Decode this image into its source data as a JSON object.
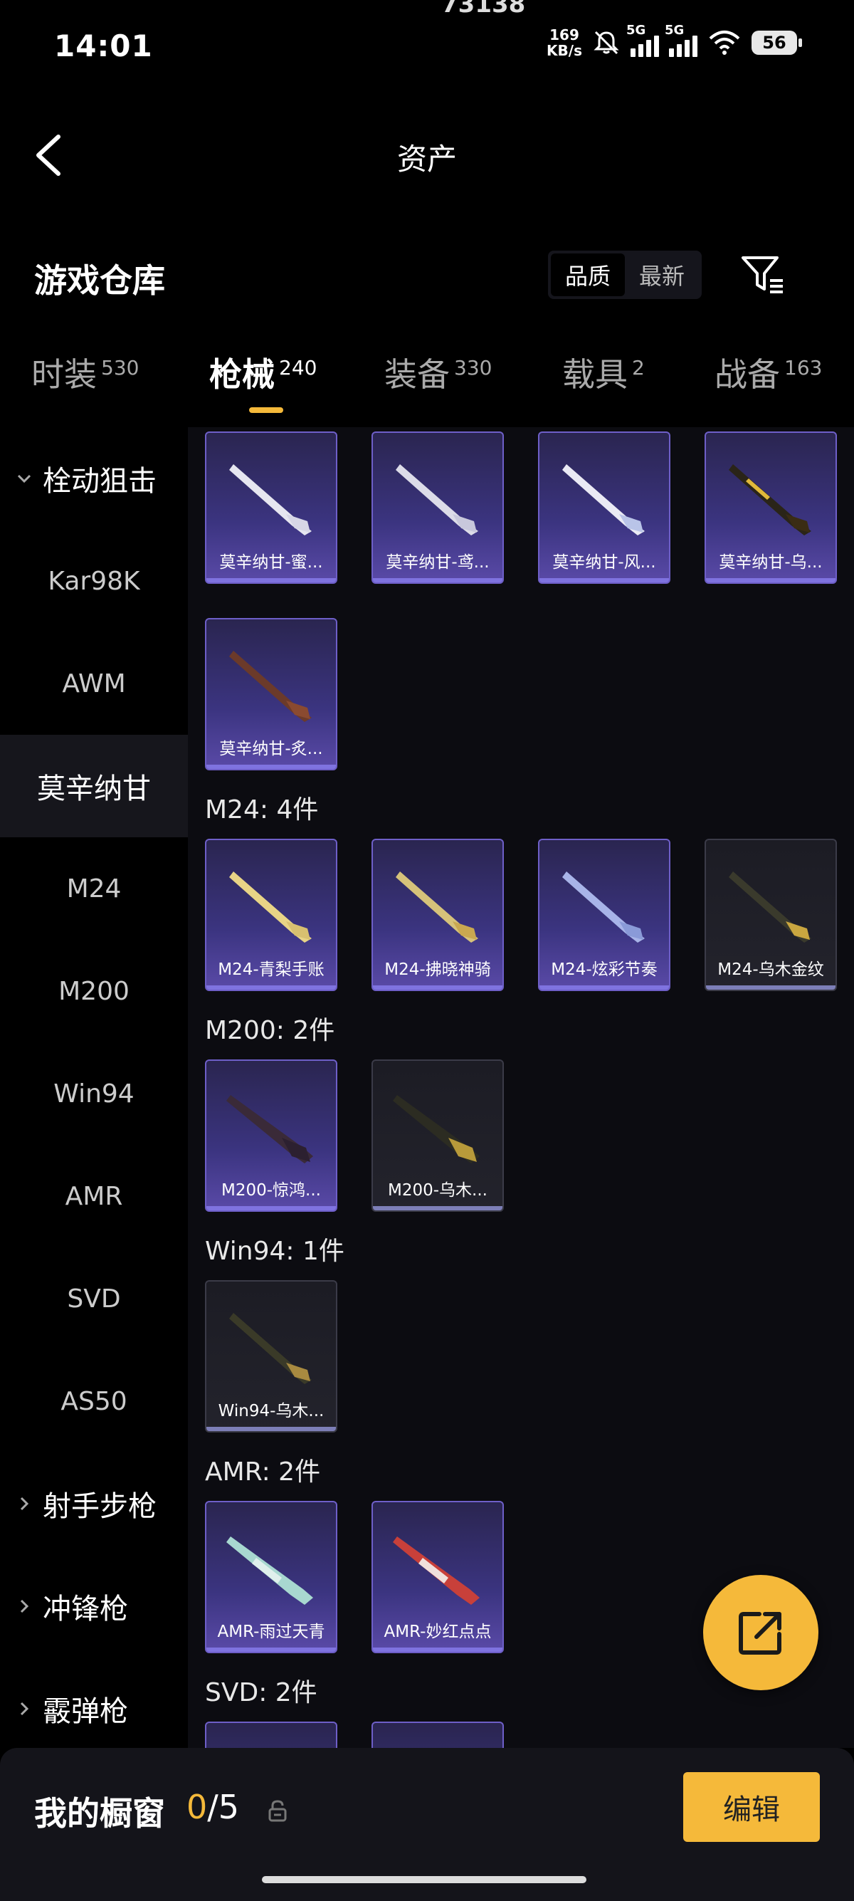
{
  "status_bar": {
    "time": "14:01",
    "top_text": "73138",
    "net_speed_value": "169",
    "net_speed_unit": "KB/s",
    "sim1_label": "5G",
    "sim2_label": "5G",
    "battery": "56"
  },
  "header": {
    "title": "资产"
  },
  "toolbar": {
    "warehouse_label": "游戏仓库",
    "sort_options": [
      "品质",
      "最新"
    ],
    "sort_active": "品质"
  },
  "tabs": [
    {
      "label": "时装",
      "count": "530"
    },
    {
      "label": "枪械",
      "count": "240"
    },
    {
      "label": "装备",
      "count": "330"
    },
    {
      "label": "载具",
      "count": "2"
    },
    {
      "label": "战备",
      "count": "163"
    }
  ],
  "active_tab": "枪械",
  "sidebar": {
    "groups": {
      "bolt": "栓动狙击",
      "dmr": "射手步枪",
      "smg": "冲锋枪",
      "shotgun": "霰弹枪"
    },
    "items": [
      "Kar98K",
      "AWM",
      "莫辛纳甘",
      "M24",
      "M200",
      "Win94",
      "AMR",
      "SVD",
      "AS50"
    ],
    "active_item": "莫辛纳甘"
  },
  "content": {
    "mosin_items": [
      "莫辛纳甘-蜜...",
      "莫辛纳甘-鸢...",
      "莫辛纳甘-风...",
      "莫辛纳甘-乌...",
      "莫辛纳甘-炙..."
    ],
    "m24_title": "M24: 4件",
    "m24_items": [
      "M24-青梨手账",
      "M24-拂晓神骑",
      "M24-炫彩节奏",
      "M24-乌木金纹"
    ],
    "m200_title": "M200: 2件",
    "m200_items": [
      "M200-惊鸿...",
      "M200-乌木..."
    ],
    "win94_title": "Win94: 1件",
    "win94_items": [
      "Win94-乌木..."
    ],
    "amr_title": "AMR: 2件",
    "amr_items": [
      "AMR-雨过天青",
      "AMR-妙红点点"
    ],
    "svd_title": "SVD: 2件"
  },
  "bottom_bar": {
    "showcase_label": "我的橱窗",
    "showcase_current": "0",
    "showcase_total": "/5",
    "edit_label": "编辑"
  },
  "colors": {
    "accent": "#f5b93a",
    "purple_card": "#3b3480",
    "background": "#000000"
  }
}
